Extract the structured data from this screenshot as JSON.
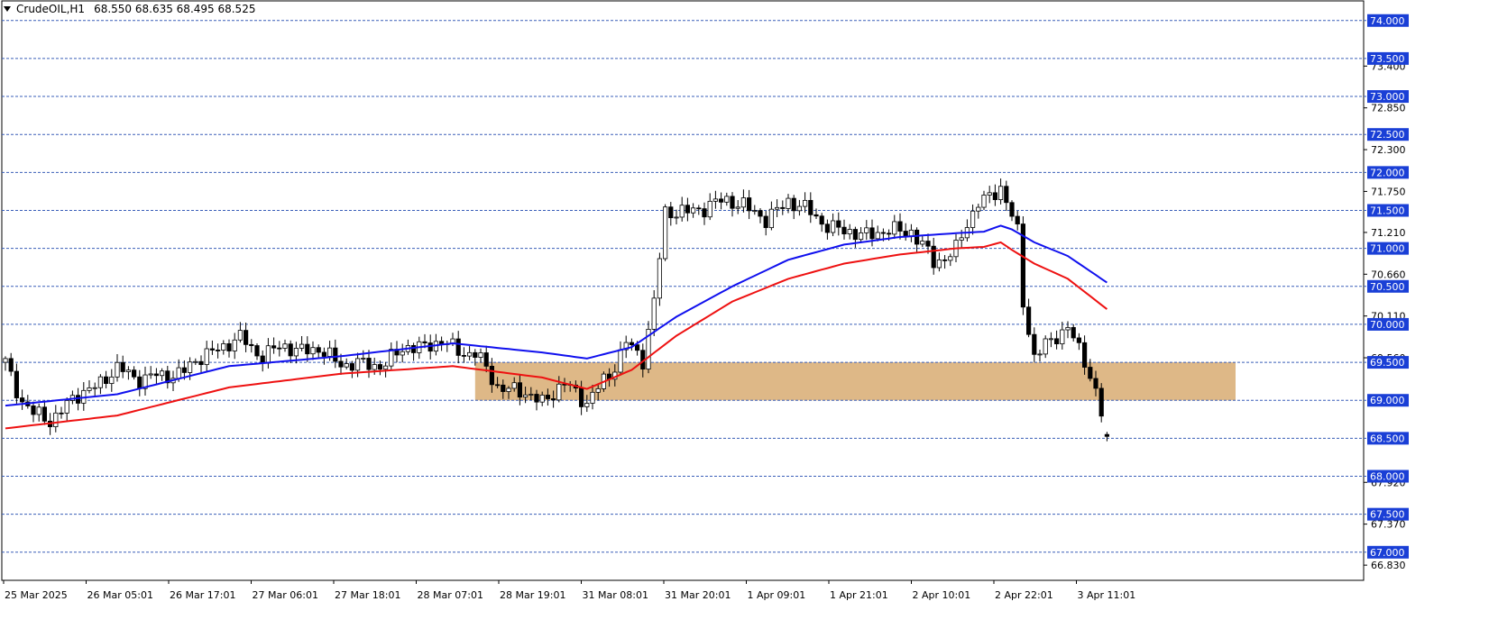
{
  "header": {
    "symbol_tf": "CrudeOIL,H1",
    "ohlc": "68.550 68.635 68.495 68.525"
  },
  "colors": {
    "background": "#ffffff",
    "grid": "#3a5fb8",
    "ema_fast": "#1010ee",
    "ema_slow": "#ee1111",
    "zone_fill": "#deb887",
    "label_bg": "#1a3fd6",
    "candle_bull": "#ffffff",
    "candle_bear": "#000000"
  },
  "chart_data": {
    "type": "candlestick",
    "ylim": [
      66.63,
      74.27
    ],
    "y_ticks": [
      "74.000",
      "73.500",
      "73.400",
      "73.000",
      "72.850",
      "72.500",
      "72.300",
      "72.000",
      "71.750",
      "71.500",
      "71.210",
      "71.000",
      "70.660",
      "70.500",
      "70.110",
      "70.000",
      "69.560",
      "69.500",
      "69.000",
      "68.500",
      "68.000",
      "67.920",
      "67.500",
      "67.370",
      "67.000",
      "66.830"
    ],
    "level_lines": [
      74.0,
      73.5,
      73.0,
      72.5,
      72.0,
      71.5,
      71.0,
      70.5,
      70.0,
      69.5,
      69.0,
      68.5,
      68.0,
      67.5,
      67.0
    ],
    "level_labels": [
      "74.000",
      "73.500",
      "73.000",
      "72.500",
      "72.000",
      "71.500",
      "71.000",
      "70.500",
      "70.000",
      "69.500",
      "69.000",
      "68.500",
      "68.000",
      "67.500",
      "67.000"
    ],
    "axis_labels": [
      "73.400",
      "72.850",
      "72.300",
      "71.750",
      "71.210",
      "70.660",
      "70.110",
      "69.560",
      "67.920",
      "67.370",
      "66.830"
    ],
    "x_labels": [
      "25 Mar 2025",
      "26 Mar 05:01",
      "26 Mar 17:01",
      "27 Mar 06:01",
      "27 Mar 18:01",
      "28 Mar 07:01",
      "28 Mar 19:01",
      "31 Mar 08:01",
      "31 Mar 20:01",
      "1 Apr 09:01",
      "1 Apr 21:01",
      "2 Apr 10:01",
      "2 Apr 22:01",
      "3 Apr 11:01"
    ],
    "zone": {
      "low": 69.0,
      "high": 69.5,
      "start_bar": 84,
      "end_bar": 220
    },
    "close_path": [
      [
        0,
        69.5
      ],
      [
        3,
        69.0
      ],
      [
        5,
        68.8
      ],
      [
        8,
        68.75
      ],
      [
        12,
        69.0
      ],
      [
        16,
        69.2
      ],
      [
        20,
        69.4
      ],
      [
        24,
        69.3
      ],
      [
        28,
        69.3
      ],
      [
        32,
        69.4
      ],
      [
        38,
        69.7
      ],
      [
        42,
        69.8
      ],
      [
        46,
        69.6
      ],
      [
        50,
        69.7
      ],
      [
        56,
        69.65
      ],
      [
        60,
        69.5
      ],
      [
        64,
        69.45
      ],
      [
        68,
        69.5
      ],
      [
        72,
        69.7
      ],
      [
        78,
        69.75
      ],
      [
        84,
        69.6
      ],
      [
        88,
        69.2
      ],
      [
        92,
        69.1
      ],
      [
        96,
        69.0
      ],
      [
        100,
        69.2
      ],
      [
        104,
        69.0
      ],
      [
        108,
        69.3
      ],
      [
        111,
        69.8
      ],
      [
        114,
        69.5
      ],
      [
        116,
        70.3
      ],
      [
        118,
        71.5
      ],
      [
        122,
        71.45
      ],
      [
        126,
        71.6
      ],
      [
        132,
        71.6
      ],
      [
        136,
        71.35
      ],
      [
        140,
        71.65
      ],
      [
        144,
        71.45
      ],
      [
        150,
        71.2
      ],
      [
        156,
        71.2
      ],
      [
        162,
        71.25
      ],
      [
        166,
        70.8
      ],
      [
        170,
        71.0
      ],
      [
        174,
        71.6
      ],
      [
        178,
        71.8
      ],
      [
        181,
        71.2
      ],
      [
        182,
        70.3
      ],
      [
        184,
        69.6
      ],
      [
        187,
        69.75
      ],
      [
        190,
        70.0
      ],
      [
        193,
        69.5
      ],
      [
        195,
        69.1
      ],
      [
        197,
        68.55
      ]
    ],
    "ema_fast": [
      [
        0,
        68.93
      ],
      [
        20,
        69.08
      ],
      [
        40,
        69.45
      ],
      [
        60,
        69.58
      ],
      [
        80,
        69.75
      ],
      [
        96,
        69.63
      ],
      [
        104,
        69.55
      ],
      [
        112,
        69.7
      ],
      [
        120,
        70.1
      ],
      [
        130,
        70.5
      ],
      [
        140,
        70.85
      ],
      [
        150,
        71.05
      ],
      [
        160,
        71.15
      ],
      [
        170,
        71.2
      ],
      [
        175,
        71.22
      ],
      [
        178,
        71.3
      ],
      [
        180,
        71.25
      ],
      [
        184,
        71.08
      ],
      [
        190,
        70.9
      ],
      [
        197,
        70.55
      ]
    ],
    "ema_slow": [
      [
        0,
        68.63
      ],
      [
        20,
        68.8
      ],
      [
        40,
        69.17
      ],
      [
        60,
        69.35
      ],
      [
        80,
        69.45
      ],
      [
        96,
        69.3
      ],
      [
        104,
        69.15
      ],
      [
        112,
        69.4
      ],
      [
        120,
        69.85
      ],
      [
        130,
        70.3
      ],
      [
        140,
        70.6
      ],
      [
        150,
        70.8
      ],
      [
        160,
        70.92
      ],
      [
        170,
        71.0
      ],
      [
        175,
        71.02
      ],
      [
        178,
        71.08
      ],
      [
        180,
        70.98
      ],
      [
        184,
        70.8
      ],
      [
        190,
        70.6
      ],
      [
        197,
        70.2
      ]
    ],
    "series": [
      {
        "name": "EMA (blue)",
        "color": "#1010ee"
      },
      {
        "name": "EMA (red)",
        "color": "#ee1111"
      }
    ]
  }
}
